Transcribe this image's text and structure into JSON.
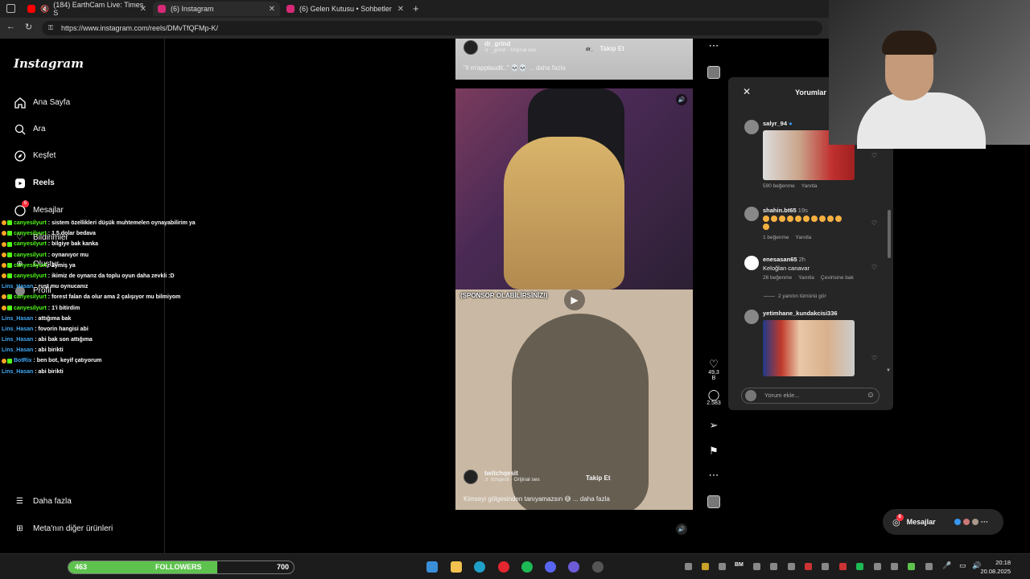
{
  "browser": {
    "tabs": [
      {
        "title": "(184) EarthCam Live: Times S",
        "color": "#ff0000"
      },
      {
        "title": "(6) Instagram",
        "color": "#d62976"
      },
      {
        "title": "(6) Gelen Kutusu • Sohbetler",
        "color": "#d62976"
      }
    ],
    "url": "https://www.instagram.com/reels/DMvTfQFMp-K/"
  },
  "sidebar": {
    "logo": "Instagram",
    "items": [
      {
        "label": "Ana Sayfa",
        "icon": "home-icon"
      },
      {
        "label": "Ara",
        "icon": "search-icon"
      },
      {
        "label": "Keşfet",
        "icon": "compass-icon"
      },
      {
        "label": "Reels",
        "icon": "reels-icon"
      },
      {
        "label": "Mesajlar",
        "icon": "messenger-icon",
        "badge": "6"
      },
      {
        "label": "Bildirimler",
        "icon": "heart-icon"
      },
      {
        "label": "Oluştur",
        "icon": "plus-icon"
      },
      {
        "label": "Profil",
        "icon": "profile-icon"
      }
    ],
    "more": "Daha fazla",
    "meta": "Meta'nın diğer ürünleri"
  },
  "chat": [
    {
      "user": "canyesilyurt",
      "msg": "sistem özellikleri düşük muhtemelen oynayabilirim ya"
    },
    {
      "user": "canyesilyurt",
      "msg": "1.5 dolar bedava"
    },
    {
      "user": "canyesilyurt",
      "msg": "bilgiye bak kanka"
    },
    {
      "user": "canyesilyurt",
      "msg": "oynanıyor mu"
    },
    {
      "user": "canyesilyurt",
      "msg": "2ymiş ya"
    },
    {
      "user": "canyesilyurt",
      "msg": "ikimiz de oynarız da toplu oyun daha zevkli :D"
    },
    {
      "user": "Lins_Hasan",
      "msg": "rust mu oynucanız"
    },
    {
      "user": "canyesilyurt",
      "msg": "forest falan da olur ama 2 çalışıyor mu bilmiyom"
    },
    {
      "user": "canyesilyurt",
      "msg": "1'i bitirdim"
    },
    {
      "user": "Lins_Hasan",
      "msg": "attığıma bak"
    },
    {
      "user": "Lins_Hasan",
      "msg": "fovorin hangisi abi"
    },
    {
      "user": "Lins_Hasan",
      "msg": "abi bak son attığıma"
    },
    {
      "user": "Lins_Hasan",
      "msg": "abi birikti"
    },
    {
      "user": "BotRix",
      "msg": "ben bot, keyif çatıyorum"
    },
    {
      "user": "Lins_Hasan",
      "msg": "abi birikti"
    }
  ],
  "reel1": {
    "user": "dr_grind",
    "audio": "♬ _grind · Orijinal ses",
    "follow": "Takip Et",
    "caption": "\"il m'applaudit..\"",
    "more": "... daha fazla",
    "watermark": "dr_"
  },
  "reel2": {
    "sponsor": "(SPONSOR OLABİLİRSİNİZ!)",
    "user": "twitchqesit",
    "audio": "♬ tchqesit · Orijinal ses",
    "follow": "Takip Et",
    "caption": "Kimseyi gölgesinden tanıyamazsın",
    "more": "... daha fazla"
  },
  "actions": {
    "likes": "49,3 B",
    "comments": "2.583"
  },
  "comments": {
    "title": "Yorumlar",
    "items": [
      {
        "user": "salyr_94",
        "time": "",
        "text": "",
        "likes": "590 beğenme",
        "reply": "Yanıtla",
        "verified": true
      },
      {
        "user": "shahin.bt65",
        "time": "19s",
        "text": "",
        "likes": "1 beğenme",
        "reply": "Yanıtla"
      },
      {
        "user": "enesasan65",
        "time": "2h",
        "text": "Keloğlan canavar",
        "likes": "26 beğenme",
        "reply": "Yanıtla",
        "translate": "Çevirisine bak"
      },
      {
        "user": "yetimhane_kundakcisi336",
        "time": "",
        "text": ""
      }
    ],
    "view_replies": "2 yanıtın tümünü gör",
    "input_placeholder": "Yorum ekle..."
  },
  "messages_pill": {
    "label": "Mesajlar",
    "badge": "6"
  },
  "followers": {
    "current": "463",
    "label": "FOLLOWERS",
    "goal": "700",
    "progress": 0.66
  },
  "clock": {
    "time": "20:18",
    "date": "20.08.2025"
  },
  "tray": {
    "lang": "BM"
  }
}
